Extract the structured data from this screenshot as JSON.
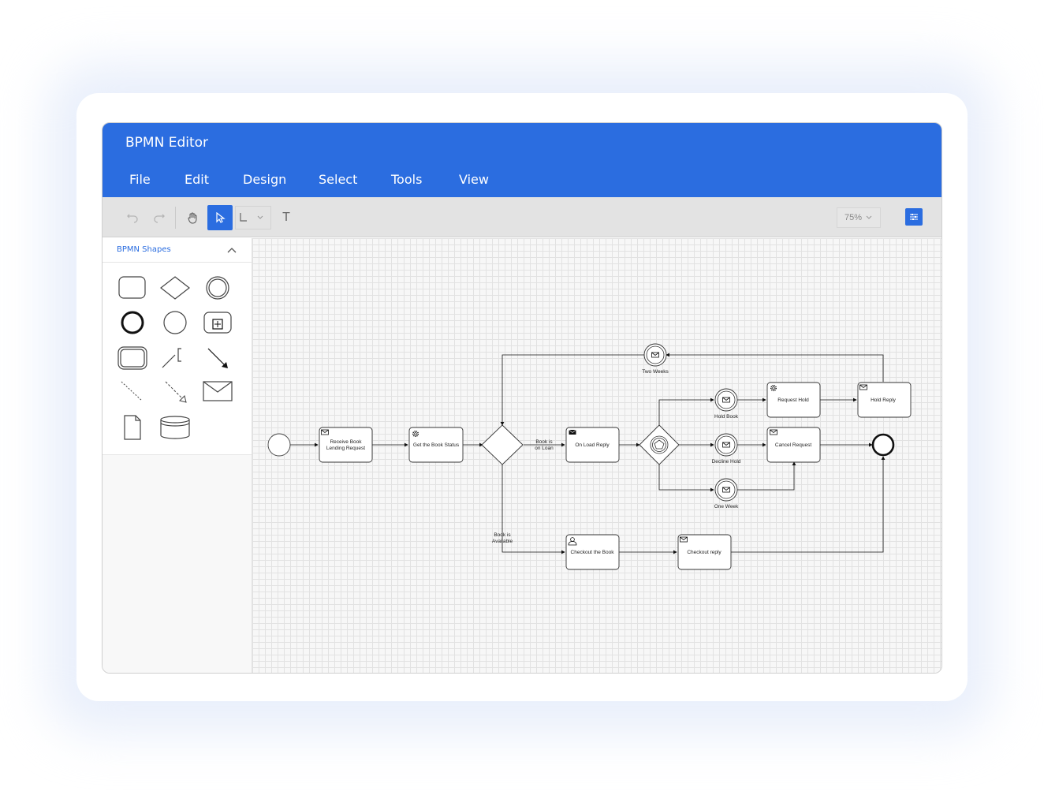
{
  "app": {
    "title": "BPMN Editor"
  },
  "menu": [
    "File",
    "Edit",
    "Design",
    "Select",
    "Tools",
    "View"
  ],
  "toolbar": {
    "zoom": "75%",
    "text_tool": "T"
  },
  "palette": {
    "title": "BPMN Shapes",
    "shapes": [
      "task",
      "gateway",
      "intermediate-event",
      "end-event",
      "start-event",
      "collapsed-subprocess",
      "transaction",
      "association",
      "sequence-flow",
      "dotted-association",
      "message-flow",
      "message",
      "data-object",
      "data-store"
    ]
  },
  "diagram": {
    "labels": {
      "receive": [
        "Receive Book",
        "Lending Request"
      ],
      "get_status": "Get the Book Status",
      "on_loan": [
        "Book is",
        "on Loan"
      ],
      "on_load_reply": "On Load Reply",
      "two_weeks": "Two Weeks",
      "hold_book": "Hold Book",
      "request_hold": "Request Hold",
      "hold_reply": "Hold Reply",
      "decline_hold": "Decline Hold",
      "cancel_request": "Cancel Request",
      "one_week": "One Week",
      "available": [
        "Book is",
        "Available"
      ],
      "checkout_book": "Checkout the Book",
      "checkout_reply": "Checkout reply"
    }
  },
  "colors": {
    "accent": "#2b6de0",
    "canvas": "#f7f7f7",
    "grid": "#e2e2e2"
  }
}
